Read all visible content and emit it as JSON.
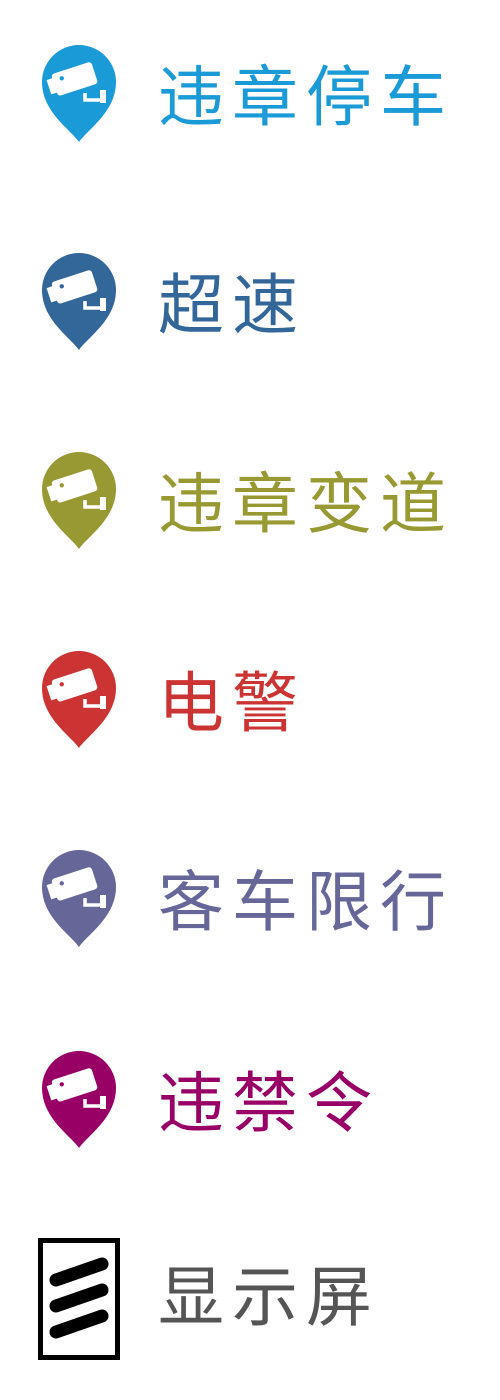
{
  "legend": {
    "items": [
      {
        "label": "违章停车",
        "color": "#1a9ad6",
        "icon": "camera-pin-icon"
      },
      {
        "label": "超速",
        "color": "#336699",
        "icon": "camera-pin-icon"
      },
      {
        "label": "违章变道",
        "color": "#999933",
        "icon": "camera-pin-icon"
      },
      {
        "label": "电警",
        "color": "#cc3333",
        "icon": "camera-pin-icon"
      },
      {
        "label": "客车限行",
        "color": "#666699",
        "icon": "camera-pin-icon"
      },
      {
        "label": "违禁令",
        "color": "#990066",
        "icon": "camera-pin-icon"
      },
      {
        "label": "显示屏",
        "color": "#555555",
        "icon": "display-screen-icon"
      }
    ]
  }
}
